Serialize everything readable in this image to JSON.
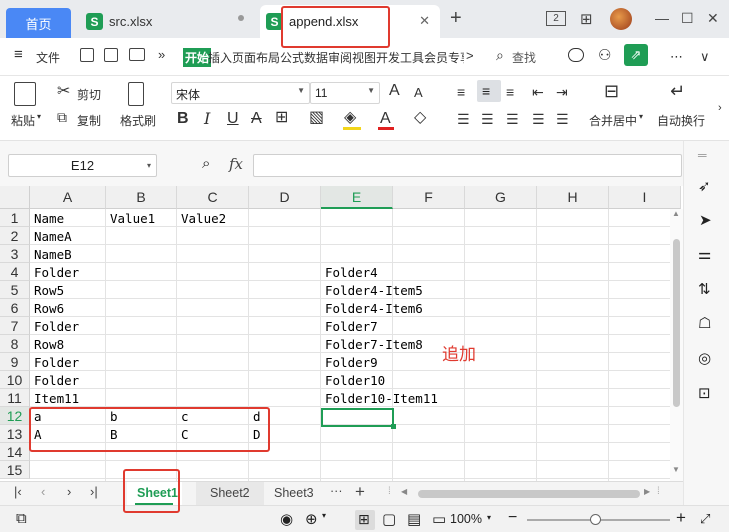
{
  "tabs": {
    "home": "首页",
    "src": "src.xlsx",
    "append": "append.xlsx",
    "s_glyph": "S",
    "add": "+"
  },
  "window": {
    "layout_badge": "2",
    "minimize": "—",
    "maximize": "☐",
    "close": "✕"
  },
  "menu": {
    "hamburger": "≡",
    "file": "文件",
    "start": "开始",
    "items": "插入页面布局公式数据审阅视图开发工具会员专享",
    "more": ">",
    "search": "查找",
    "expand": "∨"
  },
  "toolbar": {
    "paste": "粘贴",
    "cut": "剪切",
    "copy": "复制",
    "format_painter": "格式刷",
    "font_name": "宋体",
    "font_size": "11",
    "grow": "A",
    "shrink": "A",
    "bold": "B",
    "italic": "I",
    "underline": "U",
    "strike": "A",
    "font_color": "A",
    "merge_center": "合并居中",
    "wrap_text": "自动换行"
  },
  "formula": {
    "name_box": "E12",
    "fx": "fx",
    "value": ""
  },
  "columns": [
    "A",
    "B",
    "C",
    "D",
    "E",
    "F",
    "G",
    "H",
    "I"
  ],
  "rows": [
    "1",
    "2",
    "3",
    "4",
    "5",
    "6",
    "7",
    "8",
    "9",
    "10",
    "11",
    "12",
    "13",
    "14",
    "15"
  ],
  "cells": {
    "A1": "Name",
    "B1": "Value1",
    "C1": "Value2",
    "A2": "NameA",
    "A3": "NameB",
    "A4": "Folder",
    "E4": "Folder4",
    "A5": "Row5",
    "E5": "Folder4-Item5",
    "A6": "Row6",
    "E6": "Folder4-Item6",
    "A7": "Folder",
    "E7": "Folder7",
    "A8": "Row8",
    "E8": "Folder7-Item8",
    "A9": "Folder",
    "E9": "Folder9",
    "A10": "Folder",
    "E10": "Folder10",
    "A11": "Item11",
    "E11": "Folder10-Item11",
    "A12": "a",
    "B12": "b",
    "C12": "c",
    "D12": "d",
    "A13": "A",
    "B13": "B",
    "C13": "C",
    "D13": "D"
  },
  "annotation": "追加",
  "sheets": [
    "Sheet1",
    "Sheet2",
    "Sheet3"
  ],
  "sheet_more": "···",
  "sheet_add": "+",
  "status": {
    "zoom": "100%",
    "minus": "−",
    "plus": "+"
  },
  "colors": {
    "accent_green": "#1f9d55",
    "annotation_red": "#e03a2f",
    "home_tab_blue": "#4a88f5"
  }
}
